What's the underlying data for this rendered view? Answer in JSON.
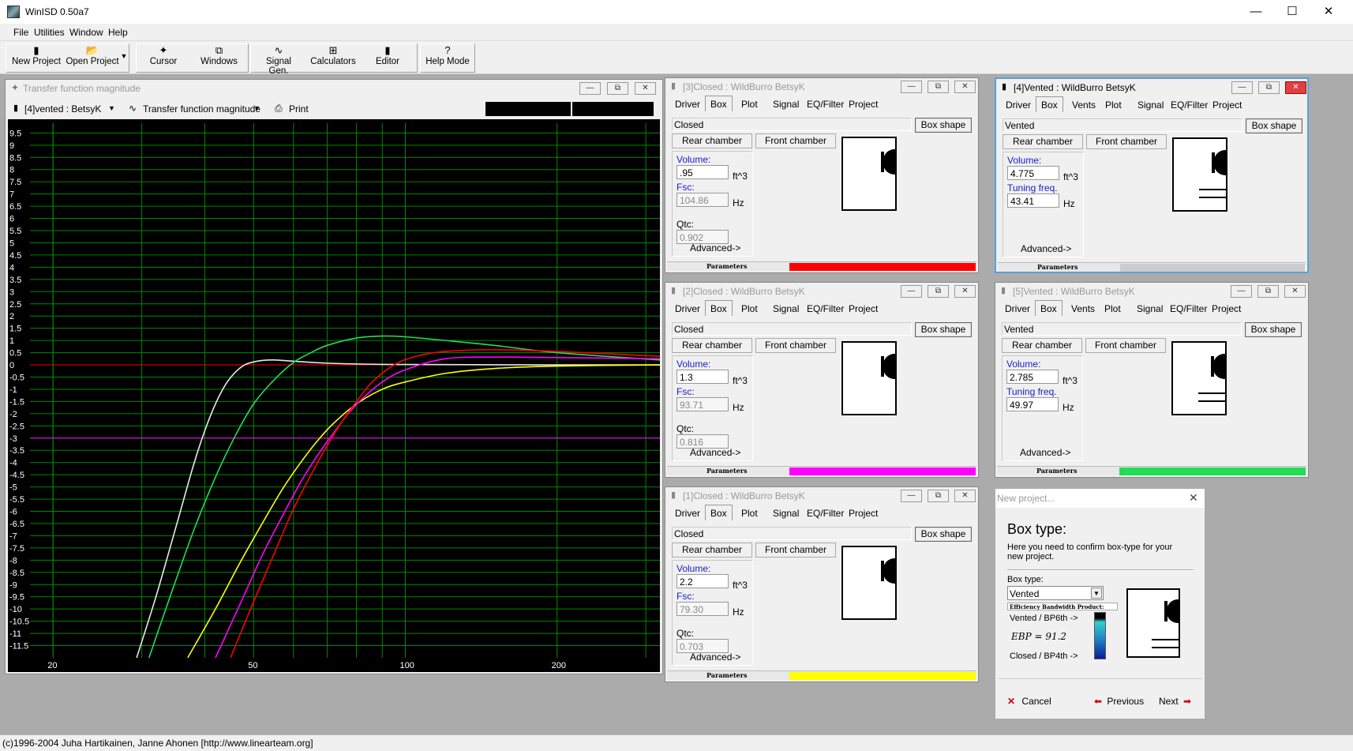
{
  "app": {
    "title": "WinISD 0.50a7"
  },
  "menu": [
    "File",
    "Utilities",
    "Window",
    "Help"
  ],
  "toolbar": {
    "new_project": "New Project",
    "open_project": "Open Project",
    "cursor": "Cursor",
    "windows": "Windows",
    "signal_gen": "Signal Gen.",
    "calculators": "Calculators",
    "editor": "Editor",
    "help_mode": "Help Mode"
  },
  "plot": {
    "window_title": "Transfer function magnitude",
    "project_select": "[4]vented : BetsyK",
    "graph_select": "Transfer function magnitude",
    "print": "Print",
    "y_ticks": [
      "9.5",
      "9",
      "8.5",
      "8",
      "7.5",
      "7",
      "6.5",
      "6",
      "5.5",
      "5",
      "4.5",
      "4",
      "3.5",
      "3",
      "2.5",
      "2",
      "1.5",
      "1",
      "0.5",
      "0",
      "-0.5",
      "-1",
      "-1.5",
      "-2",
      "-2.5",
      "-3",
      "-3.5",
      "-4",
      "-4.5",
      "-5",
      "-5.5",
      "-6",
      "-6.5",
      "-7",
      "-7.5",
      "-8",
      "-8.5",
      "-9",
      "-9.5",
      "-10",
      "-10.5",
      "-11",
      "-11.5"
    ],
    "x_ticks": [
      "20",
      "50",
      "100",
      "200"
    ]
  },
  "chart_data": {
    "type": "line",
    "x_scale": "log",
    "xlim": [
      18,
      320
    ],
    "ylim": [
      -12,
      9.9
    ],
    "grid": true,
    "background": "#000000",
    "gridcolor": "#008800",
    "hlines": [
      {
        "y": 0,
        "color": "#ff0000"
      },
      {
        "y": -3,
        "color": "#ff00ff"
      }
    ],
    "series": [
      {
        "color": "#e8e8e8",
        "x": [
          29.3,
          32,
          35,
          38,
          40,
          42,
          44,
          46,
          48,
          50,
          52,
          55,
          60,
          70,
          90,
          120,
          200,
          320
        ],
        "y": [
          -12,
          -9.5,
          -6.7,
          -4.1,
          -2.7,
          -1.6,
          -0.8,
          -0.3,
          0,
          0.12,
          0.18,
          0.2,
          0.15,
          0.07,
          0.02,
          0.01,
          0,
          0
        ]
      },
      {
        "color": "#22dd55",
        "x": [
          31,
          34,
          38,
          42,
          46,
          50,
          55,
          60,
          65,
          70,
          80,
          90,
          100,
          120,
          150,
          200,
          320
        ],
        "y": [
          -12,
          -9.6,
          -6.8,
          -4.6,
          -2.9,
          -1.6,
          -0.6,
          0.1,
          0.5,
          0.8,
          1.1,
          1.18,
          1.15,
          1.0,
          0.8,
          0.5,
          0.2
        ]
      },
      {
        "color": "#ffff00",
        "x": [
          37,
          42,
          47,
          52,
          57,
          62,
          67,
          72,
          80,
          90,
          100,
          120,
          150,
          200,
          320
        ],
        "y": [
          -12,
          -10,
          -8.1,
          -6.5,
          -5.1,
          -4.0,
          -3.1,
          -2.4,
          -1.6,
          -1.0,
          -0.7,
          -0.35,
          -0.15,
          -0.05,
          0
        ]
      },
      {
        "color": "#ff00ff",
        "x": [
          42,
          47,
          52,
          57,
          62,
          67,
          72,
          77,
          82,
          90,
          100,
          120,
          150,
          200,
          320
        ],
        "y": [
          -12,
          -9.8,
          -7.8,
          -6.2,
          -4.8,
          -3.7,
          -2.8,
          -2.0,
          -1.4,
          -0.7,
          -0.2,
          0.25,
          0.32,
          0.3,
          0.25
        ]
      },
      {
        "color": "#ff0000",
        "x": [
          45,
          50,
          55,
          60,
          65,
          70,
          75,
          80,
          86,
          95,
          105,
          120,
          150,
          200,
          320
        ],
        "y": [
          -12,
          -9.7,
          -7.7,
          -5.9,
          -4.5,
          -3.3,
          -2.3,
          -1.5,
          -0.7,
          0,
          0.35,
          0.55,
          0.62,
          0.55,
          0.35
        ]
      }
    ]
  },
  "box_windows": [
    {
      "title": "[3]Closed : WildBurro BetsyK",
      "active": false,
      "type": "Closed",
      "tabs": [
        "Driver",
        "Box",
        "Plot",
        "Signal",
        "EQ/Filter",
        "Project"
      ],
      "volume": ".95",
      "volume_unit": "ft^3",
      "freq_label": "Fsc:",
      "freq": "104.86",
      "freq_unit": "Hz",
      "qtc_label": "Qtc:",
      "qtc": "0.902",
      "color": "#ff0000"
    },
    {
      "title": "[4]Vented : WildBurro BetsyK",
      "active": true,
      "type": "Vented",
      "tabs": [
        "Driver",
        "Box",
        "Vents",
        "Plot",
        "Signal",
        "EQ/Filter",
        "Project"
      ],
      "volume": "4.775",
      "volume_unit": "ft^3",
      "freq_label": "Tuning freq.",
      "freq": "43.41",
      "freq_unit": "Hz",
      "color": "#cccccc"
    },
    {
      "title": "[2]Closed : WildBurro BetsyK",
      "active": false,
      "type": "Closed",
      "tabs": [
        "Driver",
        "Box",
        "Plot",
        "Signal",
        "EQ/Filter",
        "Project"
      ],
      "volume": "1.3",
      "volume_unit": "ft^3",
      "freq_label": "Fsc:",
      "freq": "93.71",
      "freq_unit": "Hz",
      "qtc_label": "Qtc:",
      "qtc": "0.816",
      "color": "#ff00ff"
    },
    {
      "title": "[5]Vented : WildBurro BetsyK",
      "active": false,
      "type": "Vented",
      "tabs": [
        "Driver",
        "Box",
        "Vents",
        "Plot",
        "Signal",
        "EQ/Filter",
        "Project"
      ],
      "volume": "2.785",
      "volume_unit": "ft^3",
      "freq_label": "Tuning freq.",
      "freq": "49.97",
      "freq_unit": "Hz",
      "color": "#22dd55"
    },
    {
      "title": "[1]Closed : WildBurro BetsyK",
      "active": false,
      "type": "Closed",
      "tabs": [
        "Driver",
        "Box",
        "Plot",
        "Signal",
        "EQ/Filter",
        "Project"
      ],
      "volume": "2.2",
      "volume_unit": "ft^3",
      "freq_label": "Fsc:",
      "freq": "79.30",
      "freq_unit": "Hz",
      "qtc_label": "Qtc:",
      "qtc": "0.703",
      "color": "#ffff00"
    }
  ],
  "box_common": {
    "box_shape": "Box shape",
    "rear_chamber": "Rear chamber",
    "front_chamber": "Front chamber",
    "volume_label": "Volume:",
    "advanced": "Advanced->",
    "parameters": "Parameters"
  },
  "wizard": {
    "title": "New project...",
    "heading": "Box type:",
    "description": "Here you need to confirm box-type for your new project.",
    "box_type_label": "Box type:",
    "box_type_value": "Vented",
    "ebp_label": "Efficiency Bandwidth Product:",
    "ebp_high": "Vented / BP6th ->",
    "ebp_value": "EBP = 91.2",
    "ebp_low": "Closed / BP4th ->",
    "cancel": "Cancel",
    "previous": "Previous",
    "next": "Next"
  },
  "status": "(c)1996-2004 Juha Hartikainen, Janne Ahonen [http://www.linearteam.org]"
}
